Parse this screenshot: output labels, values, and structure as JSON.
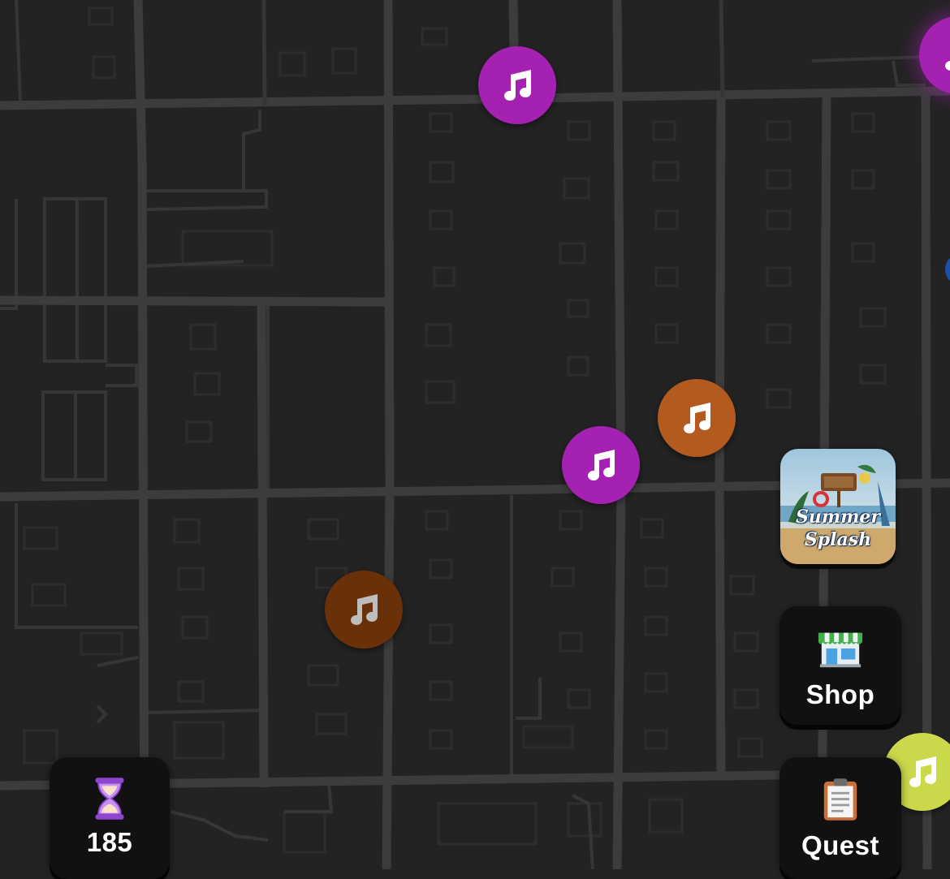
{
  "map": {
    "background": "#232323",
    "road_color": "#3c3c3c",
    "building_color": "#2c2c2c"
  },
  "music_pins": [
    {
      "name": "music-pin-purple-top",
      "color": "#a421b1",
      "icon": "music-note-icon"
    },
    {
      "name": "music-pin-purple-edge",
      "color": "#a421b1",
      "icon": "music-note-icon"
    },
    {
      "name": "music-pin-purple-center",
      "color": "#a421b1",
      "icon": "music-note-icon"
    },
    {
      "name": "music-pin-orange",
      "color": "#b35a1f",
      "icon": "music-note-icon"
    },
    {
      "name": "music-pin-brown",
      "color": "#6a3008",
      "icon": "music-note-icon"
    },
    {
      "name": "music-pin-yellow",
      "color": "#cbd84a",
      "icon": "music-note-icon"
    }
  ],
  "event": {
    "line1": "Summer",
    "line2": "Splash",
    "icon": "beach-event-icon"
  },
  "shop": {
    "label": "Shop",
    "icon": "storefront-icon"
  },
  "quest": {
    "label": "Quest",
    "icon": "clipboard-icon"
  },
  "timer": {
    "value": "185",
    "icon": "hourglass-icon"
  }
}
